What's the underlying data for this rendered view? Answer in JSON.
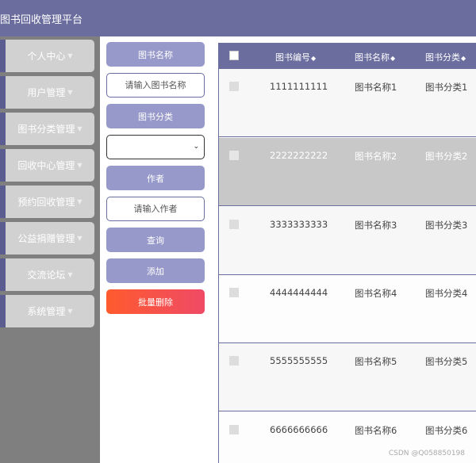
{
  "app": {
    "title": "图书回收管理平台"
  },
  "colors": {
    "header": "#6a6d9e",
    "sidebar_bg": "#7f7f7f",
    "menu_item": "#d1d1d1",
    "accent": "#9699c9",
    "danger": "#ff5b2e",
    "row_alt": "#c8c8c8",
    "row": "#f7f7f7"
  },
  "sidebar": {
    "items": [
      {
        "label": "个人中心",
        "icon": "caret-down-icon"
      },
      {
        "label": "用户管理",
        "icon": "caret-down-icon"
      },
      {
        "label": "图书分类管理",
        "icon": "caret-down-icon"
      },
      {
        "label": "回收中心管理",
        "icon": "caret-down-icon"
      },
      {
        "label": "预约回收管理",
        "icon": "caret-down-icon"
      },
      {
        "label": "公益捐赠管理",
        "icon": "caret-down-icon"
      },
      {
        "label": "交流论坛",
        "icon": "caret-down-icon"
      },
      {
        "label": "系统管理",
        "icon": "caret-down-icon"
      }
    ]
  },
  "filters": {
    "book_name_label": "图书名称",
    "book_name_placeholder": "请输入图书名称",
    "category_label": "图书分类",
    "category_value": "",
    "author_label": "作者",
    "author_placeholder": "请输入作者",
    "search_button": "查询",
    "add_button": "添加",
    "batch_delete_button": "批量删除"
  },
  "table": {
    "sort_icon": "sort-icon",
    "columns": [
      "图书编号",
      "图书名称",
      "图书分类"
    ],
    "rows": [
      {
        "id": "1111111111",
        "name": "图书名称1",
        "category": "图书分类1"
      },
      {
        "id": "2222222222",
        "name": "图书名称2",
        "category": "图书分类2"
      },
      {
        "id": "3333333333",
        "name": "图书名称3",
        "category": "图书分类3"
      },
      {
        "id": "4444444444",
        "name": "图书名称4",
        "category": "图书分类4"
      },
      {
        "id": "5555555555",
        "name": "图书名称5",
        "category": "图书分类5"
      },
      {
        "id": "6666666666",
        "name": "图书名称6",
        "category": "图书分类6"
      }
    ]
  },
  "watermark": "CSDN @Q058850198"
}
